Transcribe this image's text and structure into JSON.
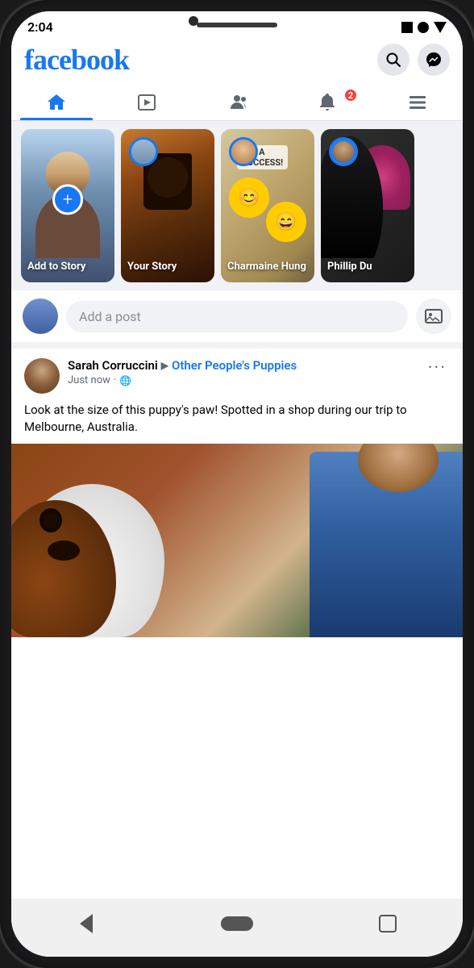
{
  "phone": {
    "status": {
      "time": "2:04"
    }
  },
  "header": {
    "logo": "facebook",
    "search_label": "search",
    "messenger_label": "messenger"
  },
  "nav": {
    "tabs": [
      {
        "label": "Home",
        "icon": "home",
        "active": true
      },
      {
        "label": "Watch",
        "icon": "play"
      },
      {
        "label": "Groups",
        "icon": "groups"
      },
      {
        "label": "Notifications",
        "icon": "bell",
        "badge": "2"
      },
      {
        "label": "Menu",
        "icon": "menu"
      }
    ]
  },
  "stories": [
    {
      "id": 1,
      "label": "Add to Story",
      "type": "add"
    },
    {
      "id": 2,
      "label": "Your Story",
      "type": "user"
    },
    {
      "id": 3,
      "label": "Charmaine Hung",
      "type": "friend"
    },
    {
      "id": 4,
      "label": "Phillip Du",
      "type": "friend"
    }
  ],
  "compose": {
    "placeholder": "Add a post"
  },
  "post": {
    "author": "Sarah Corruccini",
    "arrow": "▶",
    "group": "Other People's Puppies",
    "timestamp": "Just now",
    "privacy": "🌐",
    "text": "Look at the size of this puppy's paw! Spotted in a shop during our trip to Melbourne, Australia.",
    "more_label": "···"
  },
  "bottom_nav": {
    "back_label": "back",
    "home_label": "home",
    "recent_label": "recent"
  }
}
